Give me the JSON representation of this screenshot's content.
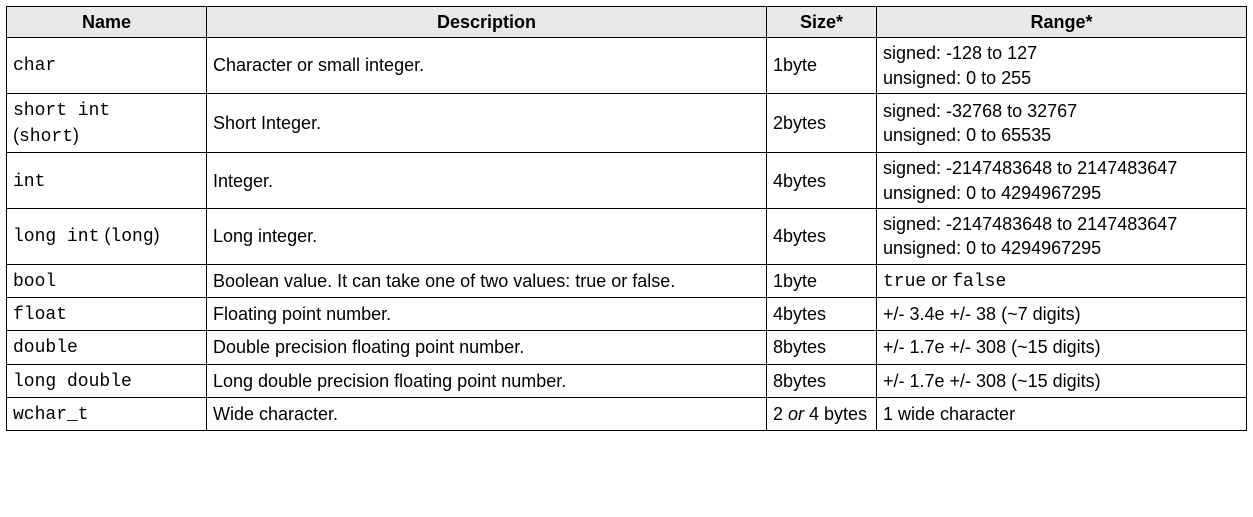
{
  "headers": {
    "name": "Name",
    "description": "Description",
    "size": "Size*",
    "range": "Range*"
  },
  "rows": [
    {
      "name_html": "<span class=\"mono\">char</span>",
      "description_html": "Character or small integer.",
      "size_html": "1byte",
      "range_html": "signed: -128 to 127<br>unsigned: 0 to 255"
    },
    {
      "name_html": "<span class=\"mono\">short int</span><br>(<span class=\"mono\">short</span>)",
      "description_html": "Short Integer.",
      "size_html": "2bytes",
      "range_html": "signed: -32768 to 32767<br>unsigned: 0 to 65535"
    },
    {
      "name_html": "<span class=\"mono\">int</span>",
      "description_html": "Integer.",
      "size_html": "4bytes",
      "range_html": "signed: -2147483648 to 2147483647<br>unsigned: 0 to 4294967295"
    },
    {
      "name_html": "<span class=\"mono\">long int</span> (<span class=\"mono\">long</span>)",
      "description_html": "Long integer.",
      "size_html": "4bytes",
      "range_html": "signed: -2147483648 to 2147483647<br>unsigned: 0 to 4294967295"
    },
    {
      "name_html": "<span class=\"mono\">bool</span>",
      "description_html": "Boolean value. It can take one of two values: true or false.",
      "size_html": "1byte",
      "range_html": "<span class=\"mono\">true</span> or <span class=\"mono\">false</span>"
    },
    {
      "name_html": "<span class=\"mono\">float</span>",
      "description_html": "Floating point number.",
      "size_html": "4bytes",
      "range_html": "+/- 3.4e +/- 38 (~7 digits)"
    },
    {
      "name_html": "<span class=\"mono\">double</span>",
      "description_html": "Double precision floating point number.",
      "size_html": "8bytes",
      "range_html": "+/- 1.7e +/- 308 (~15 digits)"
    },
    {
      "name_html": "<span class=\"mono\">long double</span>",
      "description_html": "Long double precision floating point number.",
      "size_html": "8bytes",
      "range_html": "+/- 1.7e +/- 308 (~15 digits)"
    },
    {
      "name_html": "<span class=\"mono\">wchar_t</span>",
      "description_html": "Wide character.",
      "size_html": "2 <span class=\"ital\">or</span> 4 bytes",
      "range_html": "1 wide character"
    }
  ]
}
